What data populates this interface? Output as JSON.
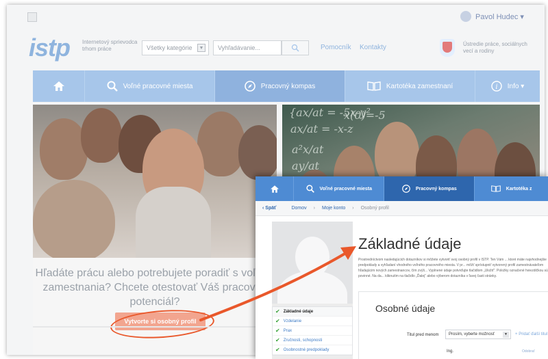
{
  "topbar": {
    "user_name": "Pavol Hudec ▾"
  },
  "logo": {
    "text": "istp",
    "tagline": "Internetový sprievodca trhom práce"
  },
  "search": {
    "category": "Všetky kategórie",
    "placeholder": "Vyhľadávanie...",
    "button_icon": "search-icon"
  },
  "links": {
    "help": "Pomocník",
    "contacts": "Kontakty"
  },
  "ministry": {
    "text": "Ústredie práce, sociálnych vecí a rodiny"
  },
  "nav": {
    "home_icon": "home-icon",
    "items": [
      {
        "label": "Voľné pracovné miesta",
        "icon": "search-icon"
      },
      {
        "label": "Pracovný kompas",
        "icon": "compass-icon"
      },
      {
        "label": "Kartotéka zamestnaní",
        "icon": "book-icon"
      },
      {
        "label": "Info ▾",
        "icon": "info-icon"
      }
    ]
  },
  "hero": {
    "text": "Hľadáte prácu alebo potrebujete poradiť s voľbou zamestnania? Chcete otestovať Váš pracovný potenciál?",
    "cta": "Vytvorte si osobný profil"
  },
  "overlay": {
    "nav": [
      {
        "label": "Voľné pracovné miesta"
      },
      {
        "label": "Pracovný kompas"
      },
      {
        "label": "Kartotéka z"
      }
    ],
    "breadcrumb": {
      "back": "‹ Späť",
      "home": "Domov",
      "account": "Moje konto",
      "current": "Osobný profil",
      "sep": "›"
    },
    "title": "Základné údaje",
    "description": "Prostredníctvom nasledujúcich dotazníkov si môžete vytvoriť svoj osobný profil v ISTP. Ten Vám ... ktoré máte najvhodnejšie predpoklady a vyhľadaní vhodného voľného pracovného miesta. V pr... môžť sprístupniť vytvorený profil zamestnávateľom hľadajúcim nových zamestnancov, čím zvýš... Vyplnené údaje potvrďujte tlačidlom „Uložiť“. Položky označené hviezdičkou sú povinné. Na da... kliknutím na tlačidlo „Ďalej“ alebo výberom dotazníka v ľavej časti stránky.",
    "menu": [
      {
        "label": "Základné údaje"
      },
      {
        "label": "Vzdelanie"
      },
      {
        "label": "Prax"
      },
      {
        "label": "Zručnosti, schopnosti"
      },
      {
        "label": "Osobnostné predpoklady"
      }
    ],
    "section_title": "Osobné údaje",
    "field_label": "Titul pred menom",
    "field_value": "Prosím, vyberte možnosť",
    "add_label": "Pridať ďalší titul",
    "ing_value": "Ing.",
    "remove_label": "Odobrať"
  },
  "colors": {
    "accent": "#4e8bd3",
    "highlight": "#e9582b"
  }
}
